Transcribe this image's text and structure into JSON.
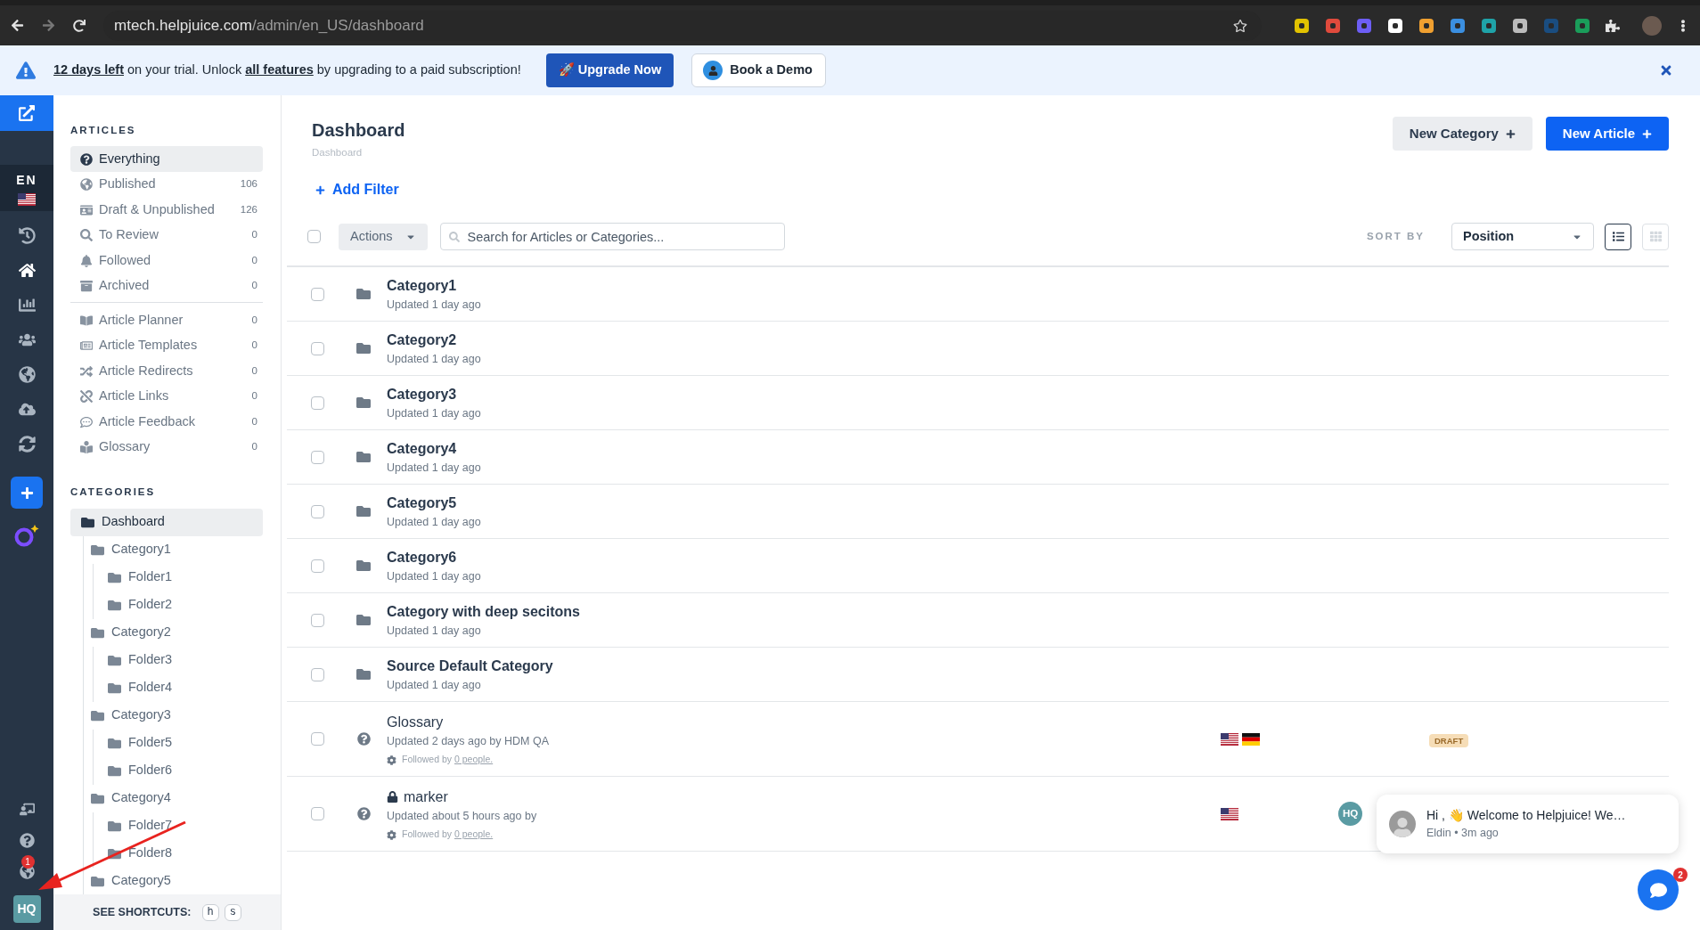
{
  "browser": {
    "url_host": "mtech.helpjuice.com",
    "url_path": "/admin/en_US/dashboard",
    "extensions": [
      {
        "color": "#e2c200"
      },
      {
        "color": "#e04a3c"
      },
      {
        "color": "#6d5ef5"
      },
      {
        "color": "#ffffff"
      },
      {
        "color": "#f0a030"
      },
      {
        "color": "#3b8fe0"
      },
      {
        "color": "#1fa3a8"
      },
      {
        "color": "#bbbbbb"
      },
      {
        "color": "#1a4d80"
      },
      {
        "color": "#1a9d5a"
      }
    ]
  },
  "banner": {
    "parts": [
      {
        "kind": "link",
        "text": "12 days left"
      },
      {
        "kind": "text",
        "text": " on your trial. Unlock "
      },
      {
        "kind": "link",
        "text": "all features"
      },
      {
        "kind": "text",
        "text": " by upgrading to a paid subscription!"
      }
    ],
    "upgrade_button": "🚀 Upgrade Now",
    "demo_button": "Book a Demo"
  },
  "rail": {
    "language": "EN",
    "language_selected": true,
    "items": [
      {
        "selected": false
      },
      {
        "selected": true
      },
      {
        "selected": false
      },
      {
        "selected": false
      },
      {
        "selected": false
      },
      {
        "selected": false
      },
      {
        "selected": false
      }
    ],
    "notification_count": "1",
    "avatar": "HQ"
  },
  "articles": {
    "heading": "ARTICLES",
    "groups": [
      [
        {
          "label": "Everything",
          "selected": true
        },
        {
          "label": "Published",
          "count": "106",
          "selected": false
        },
        {
          "label": "Draft & Unpublished",
          "count": "126",
          "selected": false
        },
        {
          "label": "To Review",
          "count": "0",
          "selected": false
        },
        {
          "label": "Followed",
          "count": "0",
          "selected": false
        },
        {
          "label": "Archived",
          "count": "0",
          "selected": false
        }
      ],
      [
        {
          "label": "Article Planner",
          "count": "0",
          "selected": false
        },
        {
          "label": "Article Templates",
          "count": "0",
          "selected": false
        },
        {
          "label": "Article Redirects",
          "count": "0",
          "selected": false
        },
        {
          "label": "Article Links",
          "count": "0",
          "selected": false
        },
        {
          "label": "Article Feedback",
          "count": "0",
          "selected": false
        },
        {
          "label": "Glossary",
          "count": "0",
          "selected": false
        }
      ]
    ]
  },
  "categories": {
    "heading": "CATEGORIES",
    "tree": [
      {
        "label": "Dashboard",
        "selected": true,
        "children": [
          {
            "label": "Category1",
            "selected": false,
            "children": [
              {
                "label": "Folder1",
                "selected": false
              },
              {
                "label": "Folder2",
                "selected": false
              }
            ]
          },
          {
            "label": "Category2",
            "selected": false,
            "children": [
              {
                "label": "Folder3",
                "selected": false
              },
              {
                "label": "Folder4",
                "selected": false
              }
            ]
          },
          {
            "label": "Category3",
            "selected": false,
            "children": [
              {
                "label": "Folder5",
                "selected": false
              },
              {
                "label": "Folder6",
                "selected": false
              }
            ]
          },
          {
            "label": "Category4",
            "selected": false,
            "children": [
              {
                "label": "Folder7",
                "selected": false
              },
              {
                "label": "Folder8",
                "selected": false
              }
            ]
          },
          {
            "label": "Category5",
            "selected": false
          }
        ]
      }
    ]
  },
  "shortcuts": {
    "label": "SEE SHORTCUTS:",
    "keys": [
      "h",
      "s"
    ]
  },
  "main": {
    "title": "Dashboard",
    "breadcrumb": "Dashboard",
    "new_category": "New Category",
    "new_article": "New Article",
    "add_filter": "Add Filter",
    "select_all_checked": false,
    "actions": "Actions",
    "search_placeholder": "Search for Articles or Categories...",
    "sort_label": "SORT BY",
    "sort_value": "Position",
    "views": [
      {
        "kind": "list",
        "selected": true
      },
      {
        "kind": "grid",
        "selected": false
      }
    ]
  },
  "rows": [
    {
      "kind": "category",
      "checked": false,
      "title": "Category1",
      "updated": "Updated 1 day ago"
    },
    {
      "kind": "category",
      "checked": false,
      "title": "Category2",
      "updated": "Updated 1 day ago"
    },
    {
      "kind": "category",
      "checked": false,
      "title": "Category3",
      "updated": "Updated 1 day ago"
    },
    {
      "kind": "category",
      "checked": false,
      "title": "Category4",
      "updated": "Updated 1 day ago"
    },
    {
      "kind": "category",
      "checked": false,
      "title": "Category5",
      "updated": "Updated 1 day ago"
    },
    {
      "kind": "category",
      "checked": false,
      "title": "Category6",
      "updated": "Updated 1 day ago"
    },
    {
      "kind": "category",
      "checked": false,
      "title": "Category with deep secitons",
      "updated": "Updated 1 day ago"
    },
    {
      "kind": "category",
      "checked": false,
      "title": "Source Default Category",
      "updated": "Updated 1 day ago"
    },
    {
      "kind": "article",
      "checked": false,
      "title": "Glossary",
      "updated": "Updated 2 days ago by HDM QA",
      "followed": "Followed by",
      "followed_link": "0 people.",
      "flags": [
        {
          "kind": "us"
        },
        {
          "kind": "de"
        }
      ],
      "badge": "DRAFT"
    },
    {
      "kind": "article",
      "checked": false,
      "locked": true,
      "title": "marker",
      "updated": "Updated about 5 hours ago by",
      "followed": "Followed by",
      "followed_link": "0 people.",
      "flags": [
        {
          "kind": "us"
        }
      ],
      "avatar": "HQ"
    }
  ],
  "chat": {
    "message": "Hi , 👋 Welcome to Helpjuice! We…",
    "meta": "Eldin • 3m ago",
    "unread": "2"
  }
}
